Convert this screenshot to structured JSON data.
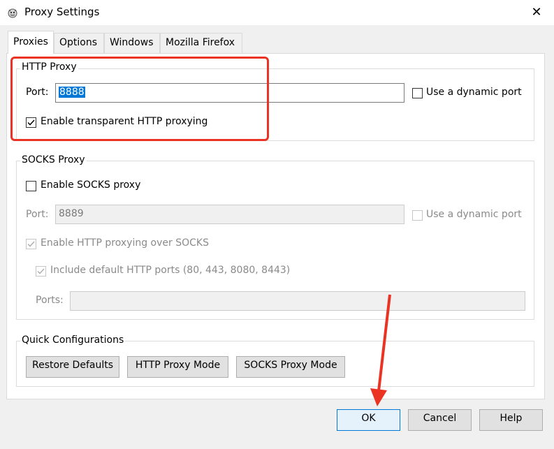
{
  "window": {
    "title": "Proxy Settings",
    "close_glyph": "✕",
    "icon": "fiddler-icon"
  },
  "tabs": [
    {
      "label": "Proxies",
      "active": true
    },
    {
      "label": "Options"
    },
    {
      "label": "Windows"
    },
    {
      "label": "Mozilla Firefox"
    }
  ],
  "http_proxy": {
    "title": "HTTP Proxy",
    "port_label": "Port:",
    "port_value": "8888",
    "dynamic_port_label": "Use a dynamic port",
    "transparent_label": "Enable transparent HTTP proxying",
    "transparent_checked": true
  },
  "socks_proxy": {
    "title": "SOCKS Proxy",
    "enable_label": "Enable SOCKS proxy",
    "port_label": "Port:",
    "port_value": "8889",
    "dynamic_port_label": "Use a dynamic port",
    "http_over_socks_label": "Enable HTTP proxying over SOCKS",
    "include_default_label": "Include default HTTP ports (80, 443, 8080, 8443)",
    "ports_label": "Ports:",
    "ports_value": ""
  },
  "quick_config": {
    "title": "Quick Configurations",
    "restore_label": "Restore Defaults",
    "http_mode_label": "HTTP Proxy Mode",
    "socks_mode_label": "SOCKS Proxy Mode"
  },
  "footer": {
    "ok_label": "OK",
    "cancel_label": "Cancel",
    "help_label": "Help"
  },
  "colors": {
    "accent": "#0078d7",
    "annotation": "#ea3323"
  }
}
